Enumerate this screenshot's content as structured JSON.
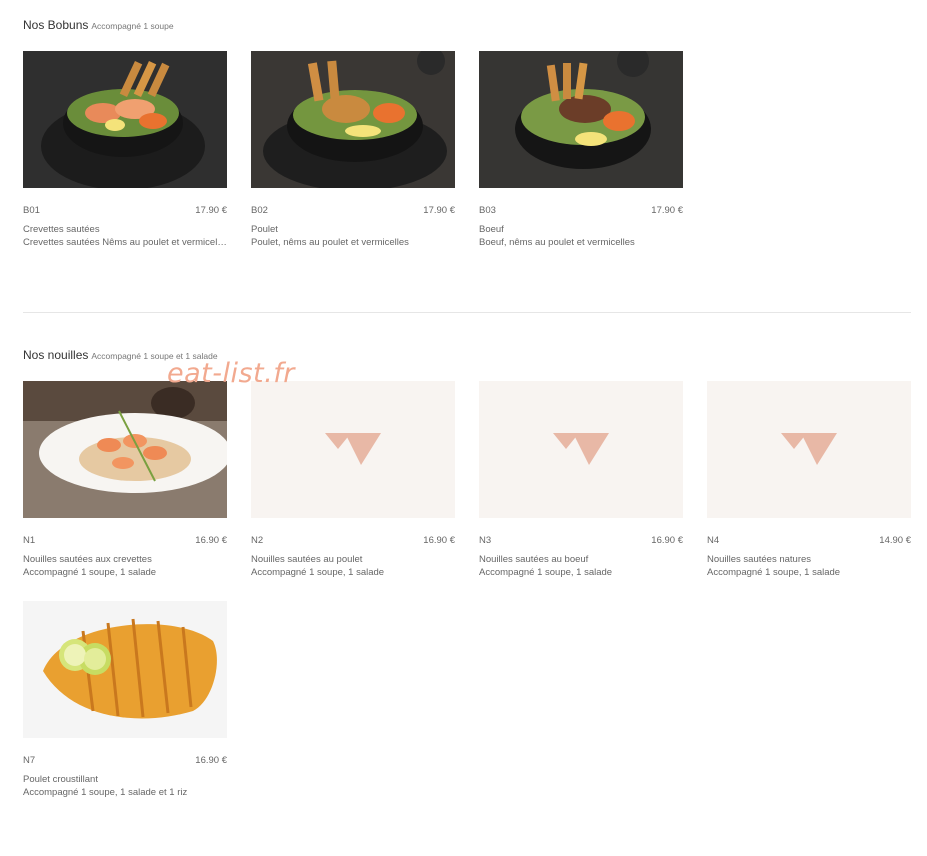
{
  "bobuns": {
    "title": "Nos Bobuns",
    "subtitle": "Accompagné 1 soupe",
    "items": [
      {
        "code": "B01",
        "price": "17.90 €",
        "name": "Crevettes sautées",
        "desc": "Crevettes sautées Nêms au poulet et vermicelles",
        "image": "bobun-shrimp-photo"
      },
      {
        "code": "B02",
        "price": "17.90 €",
        "name": "Poulet",
        "desc": "Poulet, nêms au poulet et vermicelles",
        "image": "bobun-chicken-photo"
      },
      {
        "code": "B03",
        "price": "17.90 €",
        "name": "Boeuf",
        "desc": "Boeuf, nêms au poulet et vermicelles",
        "image": "bobun-beef-photo"
      }
    ]
  },
  "nouilles": {
    "title": "Nos nouilles",
    "subtitle": "Accompagné 1 soupe et 1 salade",
    "items": [
      {
        "code": "N1",
        "price": "16.90 €",
        "name": "Nouilles sautées aux crevettes",
        "desc": "Accompagné 1 soupe, 1 salade",
        "image": "noodles-shrimp-photo"
      },
      {
        "code": "N2",
        "price": "16.90 €",
        "name": "Nouilles sautées au poulet",
        "desc": "Accompagné 1 soupe, 1 salade",
        "image": "placeholder-logo-icon"
      },
      {
        "code": "N3",
        "price": "16.90 €",
        "name": "Nouilles sautées au boeuf",
        "desc": "Accompagné 1 soupe, 1 salade",
        "image": "placeholder-logo-icon"
      },
      {
        "code": "N4",
        "price": "14.90 €",
        "name": "Nouilles sautées natures",
        "desc": "Accompagné 1 soupe, 1 salade",
        "image": "placeholder-logo-icon"
      },
      {
        "code": "N7",
        "price": "16.90 €",
        "name": "Poulet croustillant",
        "desc": "Accompagné 1 soupe, 1 salade et 1 riz",
        "image": "crispy-chicken-photo"
      }
    ]
  },
  "watermark": "eat-list.fr",
  "colors": {
    "placeholder_bg": "#f8f4f1",
    "logo": "#e8b8a6",
    "watermark": "#f2a98f"
  }
}
